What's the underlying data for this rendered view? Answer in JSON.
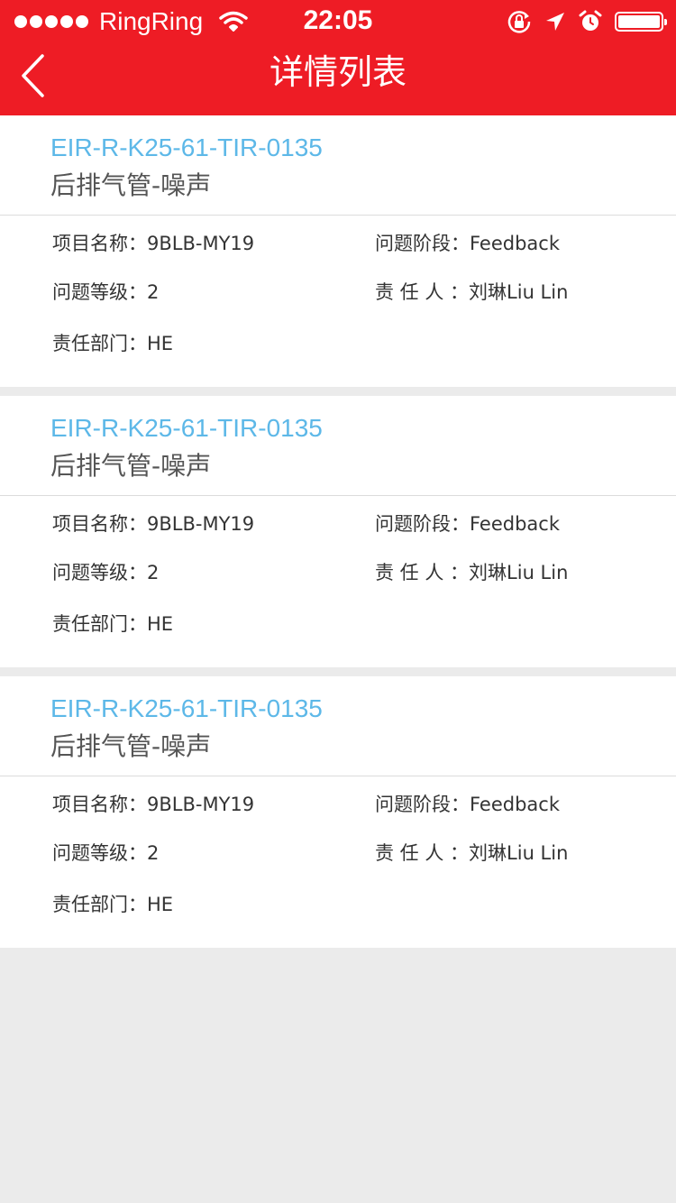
{
  "status_bar": {
    "carrier": "RingRing",
    "time": "22:05",
    "icons": [
      "signal-dots-icon",
      "wifi-icon",
      "rotation-lock-icon",
      "location-arrow-icon",
      "alarm-icon",
      "battery-icon"
    ]
  },
  "nav": {
    "title": "详情列表",
    "back_icon": "chevron-left-icon"
  },
  "colors": {
    "header_bg": "#ee1c25",
    "code_text": "#5db8e8",
    "page_bg": "#ebebeb"
  },
  "cards": [
    {
      "code": "EIR-R-K25-61-TIR-0135",
      "title": "后排气管-噪声",
      "fields": [
        {
          "label": "项目名称：",
          "value": "9BLB-MY19"
        },
        {
          "label": "问题阶段：",
          "value": "Feedback"
        },
        {
          "label": "问题等级：",
          "value": "2"
        },
        {
          "label": "责 任 人 ：",
          "value": "刘琳Liu Lin"
        },
        {
          "label": "责任部门：",
          "value": "HE"
        }
      ]
    },
    {
      "code": "EIR-R-K25-61-TIR-0135",
      "title": "后排气管-噪声",
      "fields": [
        {
          "label": "项目名称：",
          "value": "9BLB-MY19"
        },
        {
          "label": "问题阶段：",
          "value": "Feedback"
        },
        {
          "label": "问题等级：",
          "value": "2"
        },
        {
          "label": "责 任 人 ：",
          "value": "刘琳Liu Lin"
        },
        {
          "label": "责任部门：",
          "value": "HE"
        }
      ]
    },
    {
      "code": "EIR-R-K25-61-TIR-0135",
      "title": "后排气管-噪声",
      "fields": [
        {
          "label": "项目名称：",
          "value": "9BLB-MY19"
        },
        {
          "label": "问题阶段：",
          "value": "Feedback"
        },
        {
          "label": "问题等级：",
          "value": "2"
        },
        {
          "label": "责 任 人 ：",
          "value": "刘琳Liu Lin"
        },
        {
          "label": "责任部门：",
          "value": "HE"
        }
      ]
    }
  ]
}
